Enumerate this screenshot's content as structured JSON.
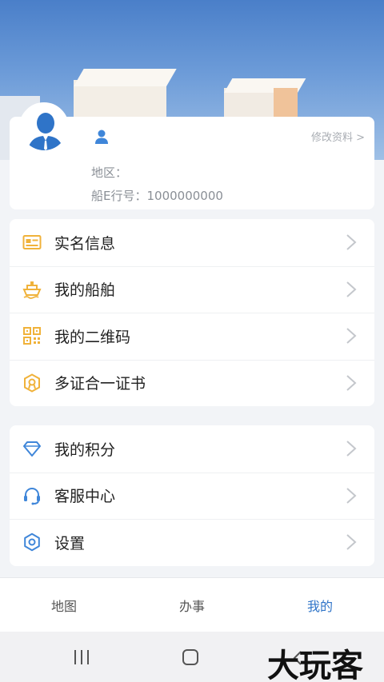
{
  "profile": {
    "edit_label": "修改资料 >",
    "region_label": "地区：",
    "ship_no_label": "船E行号：1000000000"
  },
  "menu_group_1": [
    {
      "label": "实名信息",
      "icon": "id-card-icon",
      "color": "#f0b23a"
    },
    {
      "label": "我的船舶",
      "icon": "ship-icon",
      "color": "#f0b23a"
    },
    {
      "label": "我的二维码",
      "icon": "qr-code-icon",
      "color": "#f0b23a"
    },
    {
      "label": "多证合一证书",
      "icon": "certificate-icon",
      "color": "#f0b23a"
    }
  ],
  "menu_group_2": [
    {
      "label": "我的积分",
      "icon": "diamond-icon",
      "color": "#3f86d9"
    },
    {
      "label": "客服中心",
      "icon": "headset-icon",
      "color": "#3f86d9"
    },
    {
      "label": "设置",
      "icon": "gear-icon",
      "color": "#3f86d9"
    }
  ],
  "tabs": [
    {
      "label": "地图",
      "active": false
    },
    {
      "label": "办事",
      "active": false
    },
    {
      "label": "我的",
      "active": true
    }
  ],
  "watermark": "大玩客",
  "colors": {
    "accent": "#2f74c8",
    "icon_orange": "#f0b23a",
    "icon_blue": "#3f86d9"
  }
}
